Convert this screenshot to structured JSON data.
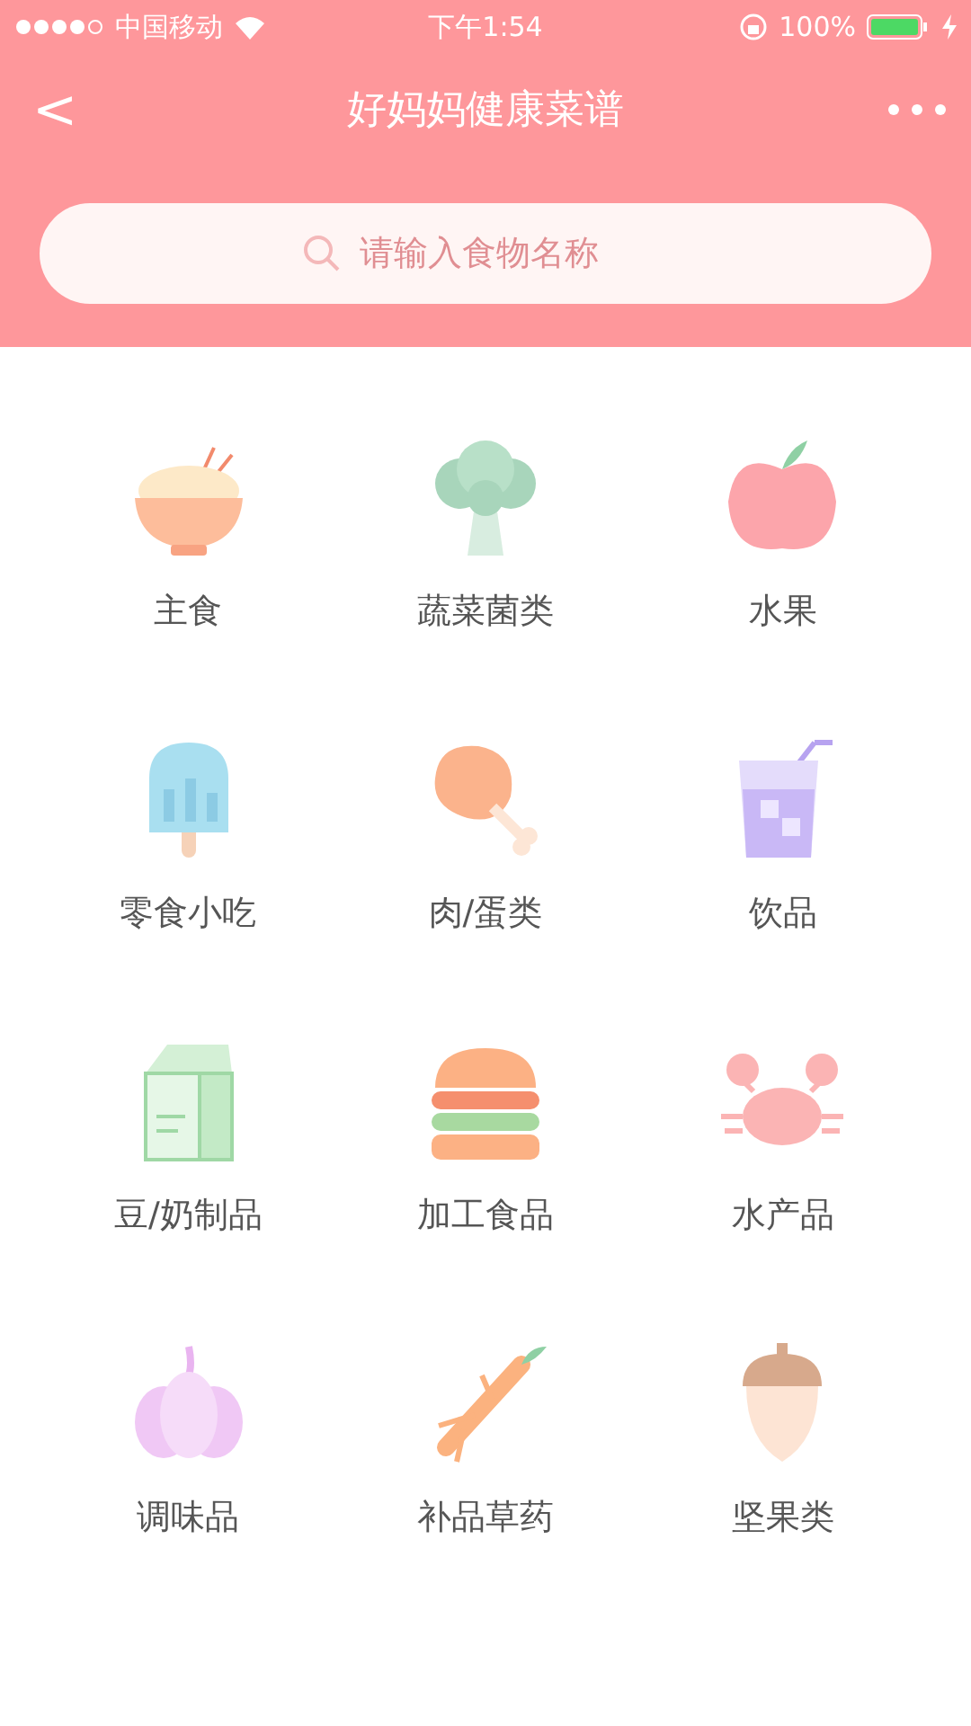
{
  "status_bar": {
    "carrier": "中国移动",
    "time": "下午1:54",
    "battery": "100%"
  },
  "header": {
    "back": "<",
    "title": "好妈妈健康菜谱"
  },
  "search": {
    "placeholder": "请输入食物名称"
  },
  "categories": [
    {
      "label": "主食"
    },
    {
      "label": "蔬菜菌类"
    },
    {
      "label": "水果"
    },
    {
      "label": "零食小吃"
    },
    {
      "label": "肉/蛋类"
    },
    {
      "label": "饮品"
    },
    {
      "label": "豆/奶制品"
    },
    {
      "label": "加工食品"
    },
    {
      "label": "水产品"
    },
    {
      "label": "调味品"
    },
    {
      "label": "补品草药"
    },
    {
      "label": "坚果类"
    }
  ]
}
